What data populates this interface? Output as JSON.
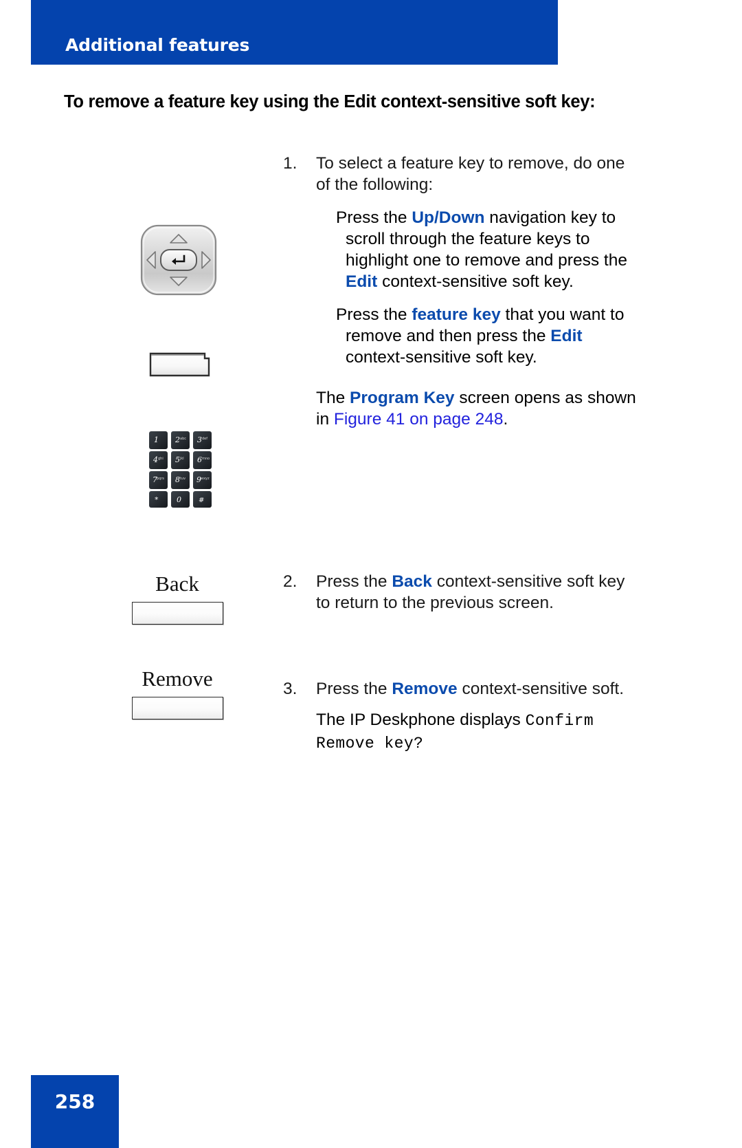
{
  "header": {
    "title": "Additional features",
    "banner_color": "#0443ad"
  },
  "heading": "To remove a feature key using the Edit context-sensitive soft key:",
  "steps": [
    {
      "number": "1.",
      "text": "To select a feature key to remove, do one of the following:",
      "sub_paragraphs": [
        {
          "parts": [
            {
              "text": "Press the  ",
              "style": "plain"
            },
            {
              "text": "Up",
              "style": "bold-blue"
            },
            {
              "text": "/",
              "style": "bold-blue-slash"
            },
            {
              "text": "Down",
              "style": "bold-blue"
            },
            {
              "text": " navigation key to scroll through the feature keys to highlight one to remove and press the ",
              "style": "plain"
            },
            {
              "text": "Edit",
              "style": "bold-blue"
            },
            {
              "text": " context-sensitive soft key.",
              "style": "plain"
            }
          ]
        },
        {
          "parts": [
            {
              "text": "Press the  ",
              "style": "plain"
            },
            {
              "text": "feature key",
              "style": "bold-blue"
            },
            {
              "text": " that you want to remove and then press the ",
              "style": "plain"
            },
            {
              "text": "Edit",
              "style": "bold-blue"
            },
            {
              "text": " context-sensitive soft key.",
              "style": "plain"
            }
          ]
        }
      ],
      "result_parts": [
        {
          "text": "The ",
          "style": "plain"
        },
        {
          "text": "Program Key",
          "style": "bold-blue"
        },
        {
          "text": " screen opens as shown in ",
          "style": "plain"
        },
        {
          "text": "Figure 41 on page 248",
          "style": "link"
        },
        {
          "text": ".",
          "style": "plain"
        }
      ]
    },
    {
      "number": "2.",
      "parts": [
        {
          "text": "Press the ",
          "style": "plain"
        },
        {
          "text": "Back",
          "style": "bold-blue"
        },
        {
          "text": " context-sensitive soft key to return to the previous screen.",
          "style": "plain"
        }
      ]
    },
    {
      "number": "3.",
      "parts": [
        {
          "text": "Press the ",
          "style": "plain"
        },
        {
          "text": "Remove",
          "style": "bold-blue"
        },
        {
          "text": " context-sensitive soft.",
          "style": "plain"
        }
      ],
      "result_parts": [
        {
          "text": "The IP Deskphone displays ",
          "style": "plain"
        },
        {
          "text": "Confirm Remove key?",
          "style": "mono"
        }
      ]
    }
  ],
  "text_blocks": {
    "step1_num": "1.",
    "step1_body": "To select a feature key to remove, do one of the following:",
    "sub1_pre": "Press the  ",
    "sub1_up": "Up",
    "sub1_slash": "/",
    "sub1_down": "Down",
    "sub1_mid": " navigation key to scroll through the feature keys to highlight one to remove and press the ",
    "sub1_edit": "Edit",
    "sub1_post": " context-sensitive soft key.",
    "sub2_pre": "Press the  ",
    "sub2_featurekey": "feature key",
    "sub2_mid": " that you want to remove and then press the ",
    "sub2_edit": "Edit",
    "sub2_post": " context-sensitive soft key.",
    "result1_pre": "The ",
    "result1_bold": "Program Key",
    "result1_mid": " screen opens as shown in ",
    "result1_link": "Figure 41 on page 248",
    "result1_post": ".",
    "step2_num": "2.",
    "step2_pre": "Press the ",
    "step2_bold": "Back",
    "step2_post": " context-sensitive soft key to return to the previous screen.",
    "step3_num": "3.",
    "step3_pre": "Press the ",
    "step3_bold": "Remove",
    "step3_post": " context-sensitive soft.",
    "result3_pre": "The IP Deskphone displays ",
    "result3_mono": "Confirm Remove key?"
  },
  "illustrations": {
    "navigation_pad": {
      "icon": "navigation-pad-icon",
      "keys": [
        "up-arrow",
        "down-arrow",
        "left-arrow",
        "right-arrow",
        "enter-center"
      ]
    },
    "feature_key": {
      "icon": "feature-key-icon"
    },
    "keypad": {
      "icon": "dialpad-icon",
      "keys": [
        [
          "1",
          "2",
          "3"
        ],
        [
          "4",
          "5",
          "6"
        ],
        [
          "7",
          "8",
          "9"
        ],
        [
          "*",
          "0",
          "#"
        ]
      ],
      "letters": [
        [
          "",
          "abc",
          "def"
        ],
        [
          "ghi",
          "jkl",
          "mno"
        ],
        [
          "pqrs",
          "tuv",
          "wxyz"
        ],
        [
          "",
          "",
          ""
        ]
      ]
    },
    "softkeys": [
      {
        "label": "Back"
      },
      {
        "label": "Remove"
      }
    ]
  },
  "footer": {
    "page_number": "258",
    "block_color": "#0443ad"
  },
  "colors": {
    "brand_blue": "#0443ad",
    "emphasis_blue": "#0b4bad",
    "link_blue": "#2222dd",
    "text_black": "#1a1a1a"
  }
}
